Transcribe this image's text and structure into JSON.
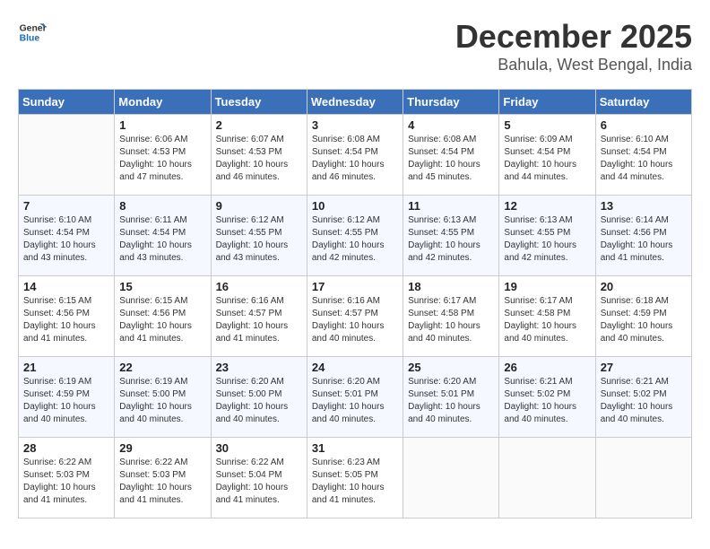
{
  "header": {
    "logo_line1": "General",
    "logo_line2": "Blue",
    "month": "December 2025",
    "location": "Bahula, West Bengal, India"
  },
  "weekdays": [
    "Sunday",
    "Monday",
    "Tuesday",
    "Wednesday",
    "Thursday",
    "Friday",
    "Saturday"
  ],
  "weeks": [
    [
      {
        "day": "",
        "info": ""
      },
      {
        "day": "1",
        "info": "Sunrise: 6:06 AM\nSunset: 4:53 PM\nDaylight: 10 hours\nand 47 minutes."
      },
      {
        "day": "2",
        "info": "Sunrise: 6:07 AM\nSunset: 4:53 PM\nDaylight: 10 hours\nand 46 minutes."
      },
      {
        "day": "3",
        "info": "Sunrise: 6:08 AM\nSunset: 4:54 PM\nDaylight: 10 hours\nand 46 minutes."
      },
      {
        "day": "4",
        "info": "Sunrise: 6:08 AM\nSunset: 4:54 PM\nDaylight: 10 hours\nand 45 minutes."
      },
      {
        "day": "5",
        "info": "Sunrise: 6:09 AM\nSunset: 4:54 PM\nDaylight: 10 hours\nand 44 minutes."
      },
      {
        "day": "6",
        "info": "Sunrise: 6:10 AM\nSunset: 4:54 PM\nDaylight: 10 hours\nand 44 minutes."
      }
    ],
    [
      {
        "day": "7",
        "info": "Sunrise: 6:10 AM\nSunset: 4:54 PM\nDaylight: 10 hours\nand 43 minutes."
      },
      {
        "day": "8",
        "info": "Sunrise: 6:11 AM\nSunset: 4:54 PM\nDaylight: 10 hours\nand 43 minutes."
      },
      {
        "day": "9",
        "info": "Sunrise: 6:12 AM\nSunset: 4:55 PM\nDaylight: 10 hours\nand 43 minutes."
      },
      {
        "day": "10",
        "info": "Sunrise: 6:12 AM\nSunset: 4:55 PM\nDaylight: 10 hours\nand 42 minutes."
      },
      {
        "day": "11",
        "info": "Sunrise: 6:13 AM\nSunset: 4:55 PM\nDaylight: 10 hours\nand 42 minutes."
      },
      {
        "day": "12",
        "info": "Sunrise: 6:13 AM\nSunset: 4:55 PM\nDaylight: 10 hours\nand 42 minutes."
      },
      {
        "day": "13",
        "info": "Sunrise: 6:14 AM\nSunset: 4:56 PM\nDaylight: 10 hours\nand 41 minutes."
      }
    ],
    [
      {
        "day": "14",
        "info": "Sunrise: 6:15 AM\nSunset: 4:56 PM\nDaylight: 10 hours\nand 41 minutes."
      },
      {
        "day": "15",
        "info": "Sunrise: 6:15 AM\nSunset: 4:56 PM\nDaylight: 10 hours\nand 41 minutes."
      },
      {
        "day": "16",
        "info": "Sunrise: 6:16 AM\nSunset: 4:57 PM\nDaylight: 10 hours\nand 41 minutes."
      },
      {
        "day": "17",
        "info": "Sunrise: 6:16 AM\nSunset: 4:57 PM\nDaylight: 10 hours\nand 40 minutes."
      },
      {
        "day": "18",
        "info": "Sunrise: 6:17 AM\nSunset: 4:58 PM\nDaylight: 10 hours\nand 40 minutes."
      },
      {
        "day": "19",
        "info": "Sunrise: 6:17 AM\nSunset: 4:58 PM\nDaylight: 10 hours\nand 40 minutes."
      },
      {
        "day": "20",
        "info": "Sunrise: 6:18 AM\nSunset: 4:59 PM\nDaylight: 10 hours\nand 40 minutes."
      }
    ],
    [
      {
        "day": "21",
        "info": "Sunrise: 6:19 AM\nSunset: 4:59 PM\nDaylight: 10 hours\nand 40 minutes."
      },
      {
        "day": "22",
        "info": "Sunrise: 6:19 AM\nSunset: 5:00 PM\nDaylight: 10 hours\nand 40 minutes."
      },
      {
        "day": "23",
        "info": "Sunrise: 6:20 AM\nSunset: 5:00 PM\nDaylight: 10 hours\nand 40 minutes."
      },
      {
        "day": "24",
        "info": "Sunrise: 6:20 AM\nSunset: 5:01 PM\nDaylight: 10 hours\nand 40 minutes."
      },
      {
        "day": "25",
        "info": "Sunrise: 6:20 AM\nSunset: 5:01 PM\nDaylight: 10 hours\nand 40 minutes."
      },
      {
        "day": "26",
        "info": "Sunrise: 6:21 AM\nSunset: 5:02 PM\nDaylight: 10 hours\nand 40 minutes."
      },
      {
        "day": "27",
        "info": "Sunrise: 6:21 AM\nSunset: 5:02 PM\nDaylight: 10 hours\nand 40 minutes."
      }
    ],
    [
      {
        "day": "28",
        "info": "Sunrise: 6:22 AM\nSunset: 5:03 PM\nDaylight: 10 hours\nand 41 minutes."
      },
      {
        "day": "29",
        "info": "Sunrise: 6:22 AM\nSunset: 5:03 PM\nDaylight: 10 hours\nand 41 minutes."
      },
      {
        "day": "30",
        "info": "Sunrise: 6:22 AM\nSunset: 5:04 PM\nDaylight: 10 hours\nand 41 minutes."
      },
      {
        "day": "31",
        "info": "Sunrise: 6:23 AM\nSunset: 5:05 PM\nDaylight: 10 hours\nand 41 minutes."
      },
      {
        "day": "",
        "info": ""
      },
      {
        "day": "",
        "info": ""
      },
      {
        "day": "",
        "info": ""
      }
    ]
  ]
}
